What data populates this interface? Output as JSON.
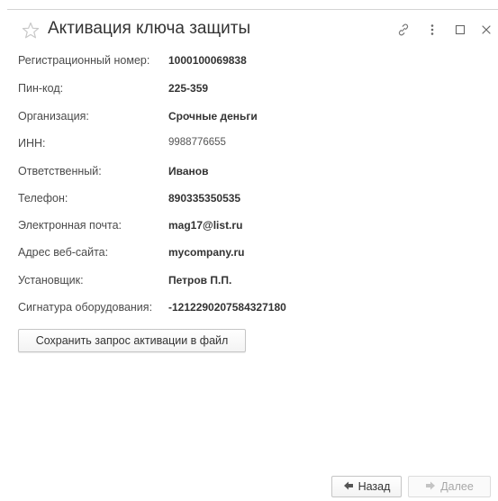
{
  "window": {
    "title": "Активация ключа защиты",
    "icons": [
      "star-icon",
      "link-icon",
      "more-icon",
      "maximize-icon",
      "close-icon"
    ]
  },
  "fields": [
    {
      "label": "Регистрационный номер:",
      "value": "1000100069838"
    },
    {
      "label": "Пин-код:",
      "value": "225-359"
    },
    {
      "label": "Организация:",
      "value": "Срочные деньги"
    },
    {
      "label": "ИНН:",
      "value": "9988776655"
    },
    {
      "label": "Ответственный:",
      "value": "Иванов"
    },
    {
      "label": "Телефон:",
      "value": "890335350535"
    },
    {
      "label": "Электронная почта:",
      "value": "mag17@list.ru"
    },
    {
      "label": "Адрес веб-сайта:",
      "value": "mycompany.ru"
    },
    {
      "label": "Установщик:",
      "value": "Петров П.П."
    },
    {
      "label": "Сигнатура оборудования:",
      "value": "-1212290207584327180"
    }
  ],
  "actions": {
    "save_label": "Сохранить запрос активации в файл",
    "back_label": "Назад",
    "next_label": "Далее"
  },
  "colors": {
    "text": "#333333",
    "label": "#4a4a4a",
    "disabled": "#a8a8a8",
    "star": "#c8c8c8",
    "arrow": "#555555"
  }
}
